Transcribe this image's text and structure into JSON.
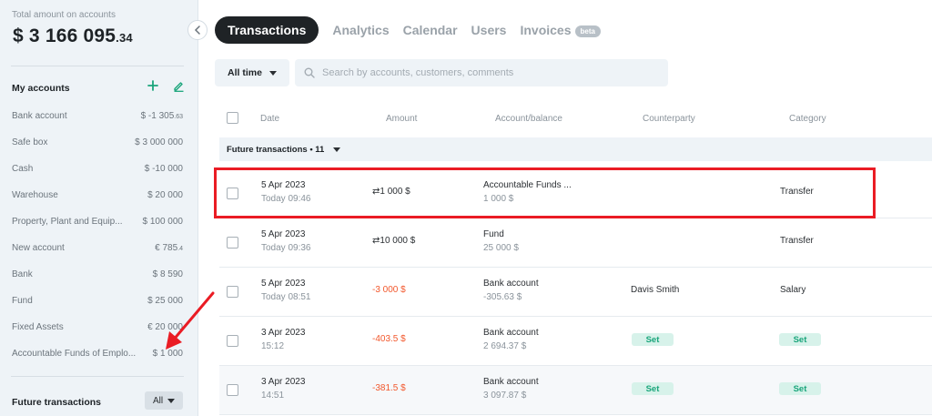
{
  "sidebar": {
    "total_label": "Total amount on accounts",
    "total_main": "$ 3 166 095",
    "total_cents": ".34",
    "my_accounts_title": "My accounts",
    "accounts": [
      {
        "name": "Bank account",
        "balance": "$ -1 305",
        "cents": ".63"
      },
      {
        "name": "Safe box",
        "balance": "$ 3 000 000",
        "cents": ""
      },
      {
        "name": "Cash",
        "balance": "$ -10 000",
        "cents": ""
      },
      {
        "name": "Warehouse",
        "balance": "$ 20 000",
        "cents": ""
      },
      {
        "name": "Property, Plant and Equip...",
        "balance": "$ 100 000",
        "cents": ""
      },
      {
        "name": "New account",
        "balance": "€ 785",
        "cents": ".4"
      },
      {
        "name": "Bank",
        "balance": "$ 8 590",
        "cents": ""
      },
      {
        "name": "Fund",
        "balance": "$ 25 000",
        "cents": ""
      },
      {
        "name": "Fixed Assets",
        "balance": "€ 20 000",
        "cents": ""
      },
      {
        "name": "Accountable Funds of Emplo...",
        "balance": "$ 1 000",
        "cents": ""
      }
    ],
    "future_title": "Future transactions",
    "future_filter": "All"
  },
  "tabs": [
    {
      "label": "Transactions",
      "active": true
    },
    {
      "label": "Analytics"
    },
    {
      "label": "Calendar"
    },
    {
      "label": "Users"
    },
    {
      "label": "Invoices"
    }
  ],
  "beta_badge": "beta",
  "filter": {
    "period": "All time"
  },
  "search": {
    "placeholder": "Search by accounts, customers, comments"
  },
  "table": {
    "headers": {
      "date": "Date",
      "amount": "Amount",
      "account": "Account/balance",
      "counterparty": "Counterparty",
      "category": "Category"
    },
    "group_label": "Future transactions • 11",
    "rows": [
      {
        "date": "5 Apr 2023",
        "time": "Today 09:46",
        "amount": "⇄1 000  $",
        "negative": false,
        "account": "Accountable Funds ...",
        "balance": "1 000  $",
        "counterparty": "",
        "category": "Transfer"
      },
      {
        "date": "5 Apr 2023",
        "time": "Today 09:36",
        "amount": "⇄10 000  $",
        "negative": false,
        "account": "Fund",
        "balance": "25 000  $",
        "counterparty": "",
        "category": "Transfer"
      },
      {
        "date": "5 Apr 2023",
        "time": "Today 08:51",
        "amount": "-3 000  $",
        "negative": true,
        "account": "Bank account",
        "balance": "-305.63  $",
        "counterparty": "Davis Smith",
        "category": "Salary"
      },
      {
        "date": "3 Apr 2023",
        "time": "15:12",
        "amount": "-403.5  $",
        "negative": true,
        "account": "Bank account",
        "balance": "2 694.37  $",
        "counterparty": "Set",
        "category": "Set"
      },
      {
        "date": "3 Apr 2023",
        "time": "14:51",
        "amount": "-381.5  $",
        "negative": true,
        "account": "Bank account",
        "balance": "3 097.87  $",
        "counterparty": "Set",
        "category": "Set"
      }
    ]
  },
  "colors": {
    "accent_dark": "#1f2326",
    "negative": "#f2582d",
    "set_pill_bg": "#d7f2ea",
    "set_pill_text": "#1aa57b",
    "highlight": "#ea1c24",
    "add_icon": "#1aa57b"
  }
}
